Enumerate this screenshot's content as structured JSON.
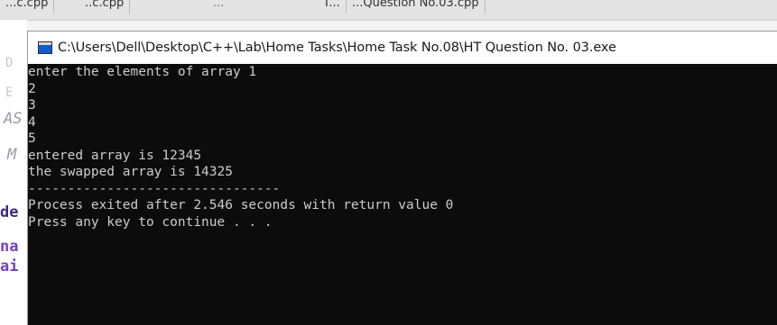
{
  "background_ide": {
    "tabs": [
      "...c.cpp",
      "..c.cpp",
      "...",
      "T...",
      "...Question No.03.cpp"
    ],
    "gutter_fragments": [
      "D",
      "E",
      "AS",
      "M",
      "de",
      "na",
      "ai"
    ]
  },
  "console": {
    "title": "C:\\Users\\Dell\\Desktop\\C++\\Lab\\Home Tasks\\Home Task No.08\\HT Question No. 03.exe",
    "lines": [
      "enter the elements of array 1",
      "2",
      "3",
      "4",
      "5",
      "entered array is 12345",
      "the swapped array is 14325",
      "--------------------------------",
      "Process exited after 2.546 seconds with return value 0",
      "Press any key to continue . . ."
    ]
  },
  "colors": {
    "console_bg": "#0c0c0c",
    "console_text": "#cccccc",
    "title_bar_bg": "#ffffff",
    "icon_blue": "#0d5fd0",
    "ide_keyword_purple": "#7a3fbf"
  },
  "icons": {
    "console_app_icon": "console-window-icon"
  }
}
